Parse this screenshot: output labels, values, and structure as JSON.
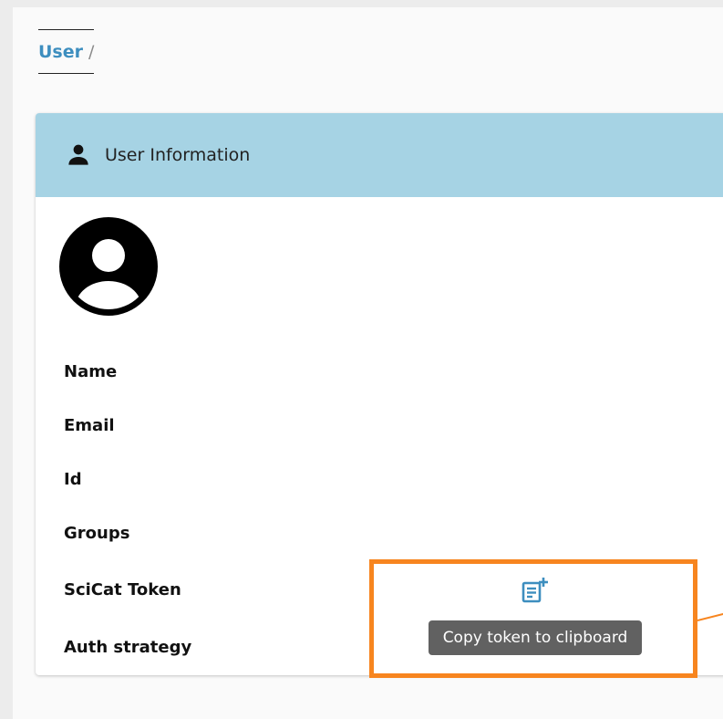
{
  "breadcrumb": {
    "link": "User",
    "separator": "/"
  },
  "card": {
    "title": "User Information"
  },
  "fields": {
    "name": "Name",
    "email": "Email",
    "id": "Id",
    "groups": "Groups",
    "token": "SciCat Token",
    "auth": "Auth strategy"
  },
  "token_actions": {
    "copy_tooltip": "Copy token to clipboard",
    "copy_icon": "note-add-icon"
  },
  "icons": {
    "header": "person-icon",
    "avatar": "account-circle-icon"
  },
  "colors": {
    "header_bg": "#a6d3e4",
    "link": "#3d8ebf",
    "highlight": "#f7851f",
    "tooltip_bg": "#616161"
  }
}
